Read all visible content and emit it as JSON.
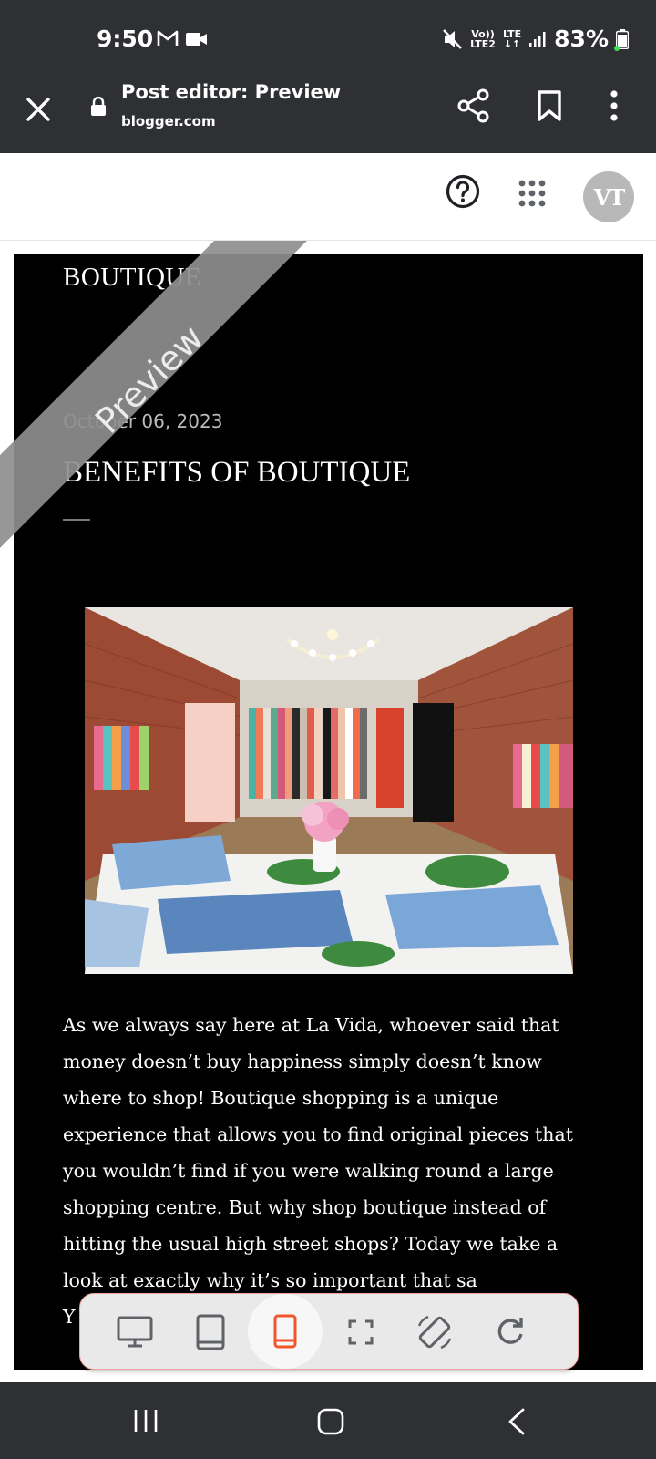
{
  "status_bar": {
    "time": "9:50",
    "net_top": "Vo))",
    "net_bottom": "LTE2",
    "lte_top": "LTE",
    "lte_bottom": "↓↑",
    "battery": "83%"
  },
  "app_bar": {
    "title": "Post editor: Preview",
    "url": "blogger.com"
  },
  "header": {
    "avatar_initials": "VT"
  },
  "post": {
    "blog_name": "BOUTIQUE",
    "date": "October 06, 2023",
    "title": "BENEFITS OF BOUTIQUE",
    "body": "As we always say here at La Vida, whoever said that money doesn’t buy happiness simply doesn’t know where to shop! Boutique shopping is a unique experience that allows you to find original pieces that you wouldn’t find if you were walking round a large shopping centre. But why shop boutique instead of hitting the usual high street shops? Today we take a look at exactly why it’s so important that sa",
    "body_tail": "Y",
    "watermark": "Preview"
  },
  "device_toolbar": {
    "buttons": [
      "desktop-icon",
      "tablet-icon",
      "phone-icon",
      "fullscreen-icon",
      "rotate-screen-icon",
      "refresh-icon"
    ],
    "active": "phone-icon",
    "active_color": "#f0562c"
  },
  "colors": {
    "chrome_bg": "#2f3033",
    "post_bg": "#000000",
    "accent": "#f0562c"
  }
}
